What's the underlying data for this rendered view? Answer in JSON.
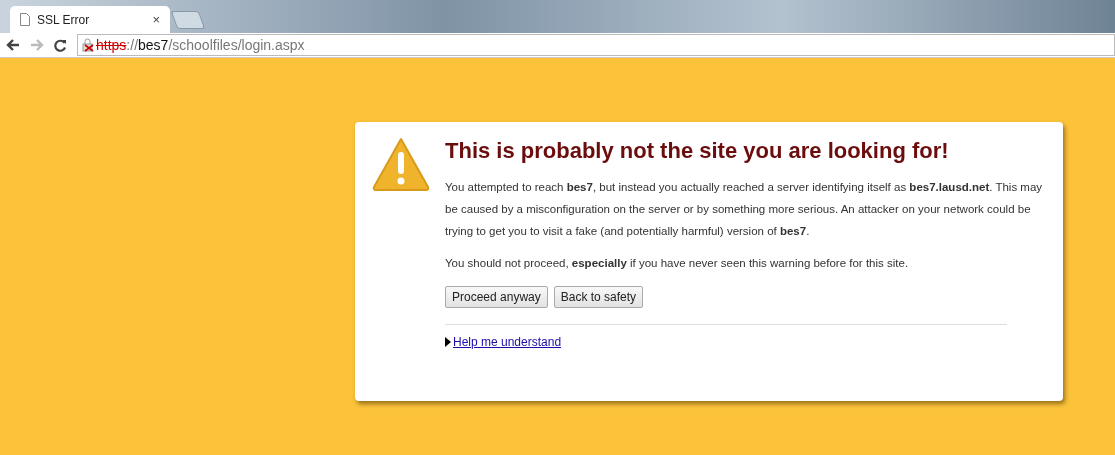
{
  "tab": {
    "title": "SSL Error",
    "close": "×",
    "selected": true
  },
  "toolbar": {
    "url": {
      "scheme": "https",
      "separator": "://",
      "host": "bes7",
      "path": "/schoolfiles/login.aspx",
      "insecure": true
    }
  },
  "warning": {
    "title": "This is probably not the site you are looking for!",
    "paragraphs": [
      "You attempted to reach **bes7**, but instead you actually reached a server identifying itself as **bes7.lausd.net**. This may be caused by a misconfiguration on the server or by something more serious. An attacker on your network could be trying to get you to visit a fake (and potentially harmful) version of **bes7**.",
      "You should not proceed, **especially** if you have never seen this warning before for this site."
    ],
    "buttons": [
      "Proceed anyway",
      "Back to safety"
    ],
    "help": {
      "label": "Help me understand",
      "expanded": false
    }
  }
}
